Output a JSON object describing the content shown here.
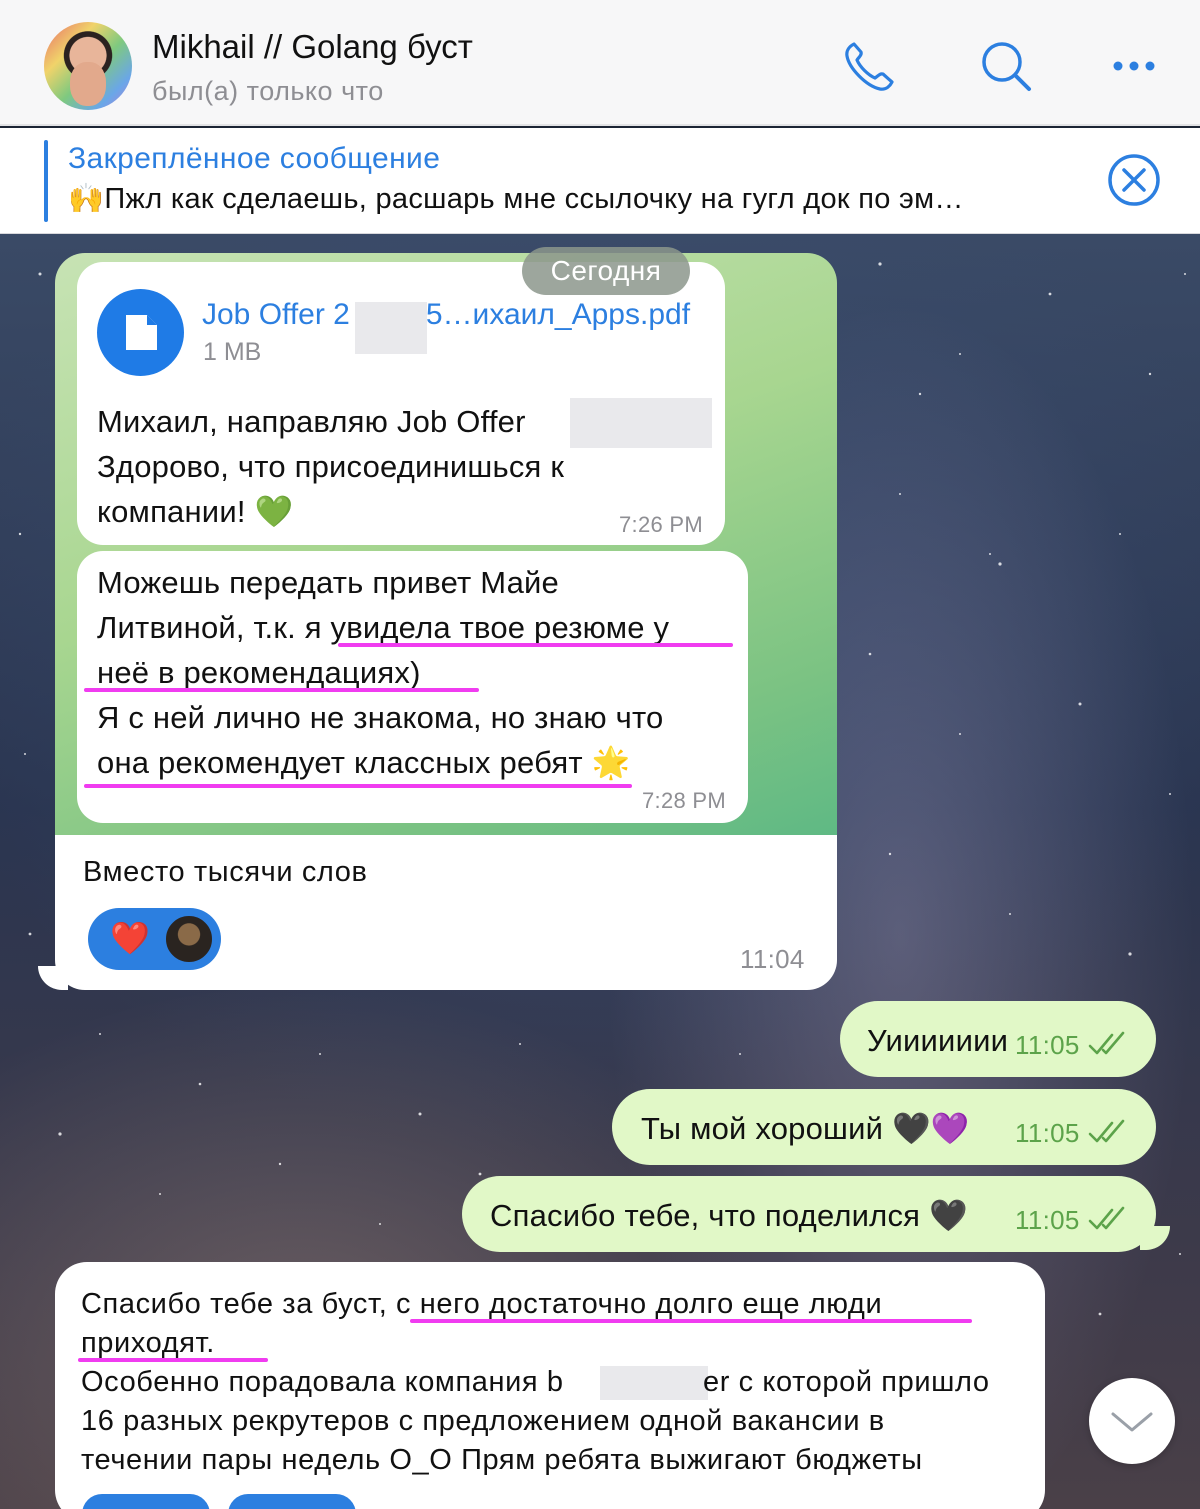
{
  "header": {
    "title": "Mikhail // Golang буст",
    "status": "был(а) только что"
  },
  "pinned": {
    "title": "Закреплённое сообщение",
    "text": "🙌Пжл как сделаешь, расшарь мне ссылочку на гугл док по эм…"
  },
  "date_badge": "Сегодня",
  "forwarded": {
    "file": {
      "name_start": "Job Offer 2",
      "name_end": "5…ихаил_Apps.pdf",
      "size": "1 MB"
    },
    "message1": {
      "lines": [
        "Михаил,  направляю Job Offer",
        "Здорово, что присоединишься к",
        "компании! 💚"
      ],
      "time": "7:26 PM"
    },
    "message2": {
      "lines": [
        "Можешь передать привет Майе",
        "Литвиной, т.к. я увидела твое резюме у",
        "неё в рекомендациях)",
        "Я с ней лично не знакома, но знаю что",
        "она рекомендует классных ребят 🌟"
      ],
      "time": "7:28 PM"
    }
  },
  "comment": {
    "text": "Вместо тысячи слов",
    "time": "11:04",
    "reaction": "❤️"
  },
  "outgoing": [
    {
      "text": "Уиииииии",
      "time": "11:05"
    },
    {
      "text": "Ты мой хороший 🖤💜",
      "time": "11:05"
    },
    {
      "text": "Спасибо тебе, что поделился 🖤",
      "time": "11:05"
    }
  ],
  "incoming_last": {
    "lines": [
      "Спасибо тебе за буст, с него достаточно долго еще люди",
      "приходят.",
      "Особенно порадовала компания b",
      "er с которой пришло",
      "16 разных рекрутеров с предложением одной вакансии в",
      "течении пары недель О_О Прям ребята выжигают бюджеты"
    ]
  },
  "colors": {
    "accent": "#2c7fe0",
    "outgoing_bubble": "#e1f8c7",
    "highlight": "#f03cf0",
    "read_check": "#5ca34a"
  },
  "icons": [
    "phone-icon",
    "search-icon",
    "more-icon",
    "close-icon",
    "file-icon",
    "double-check-icon",
    "chevron-down-icon"
  ]
}
